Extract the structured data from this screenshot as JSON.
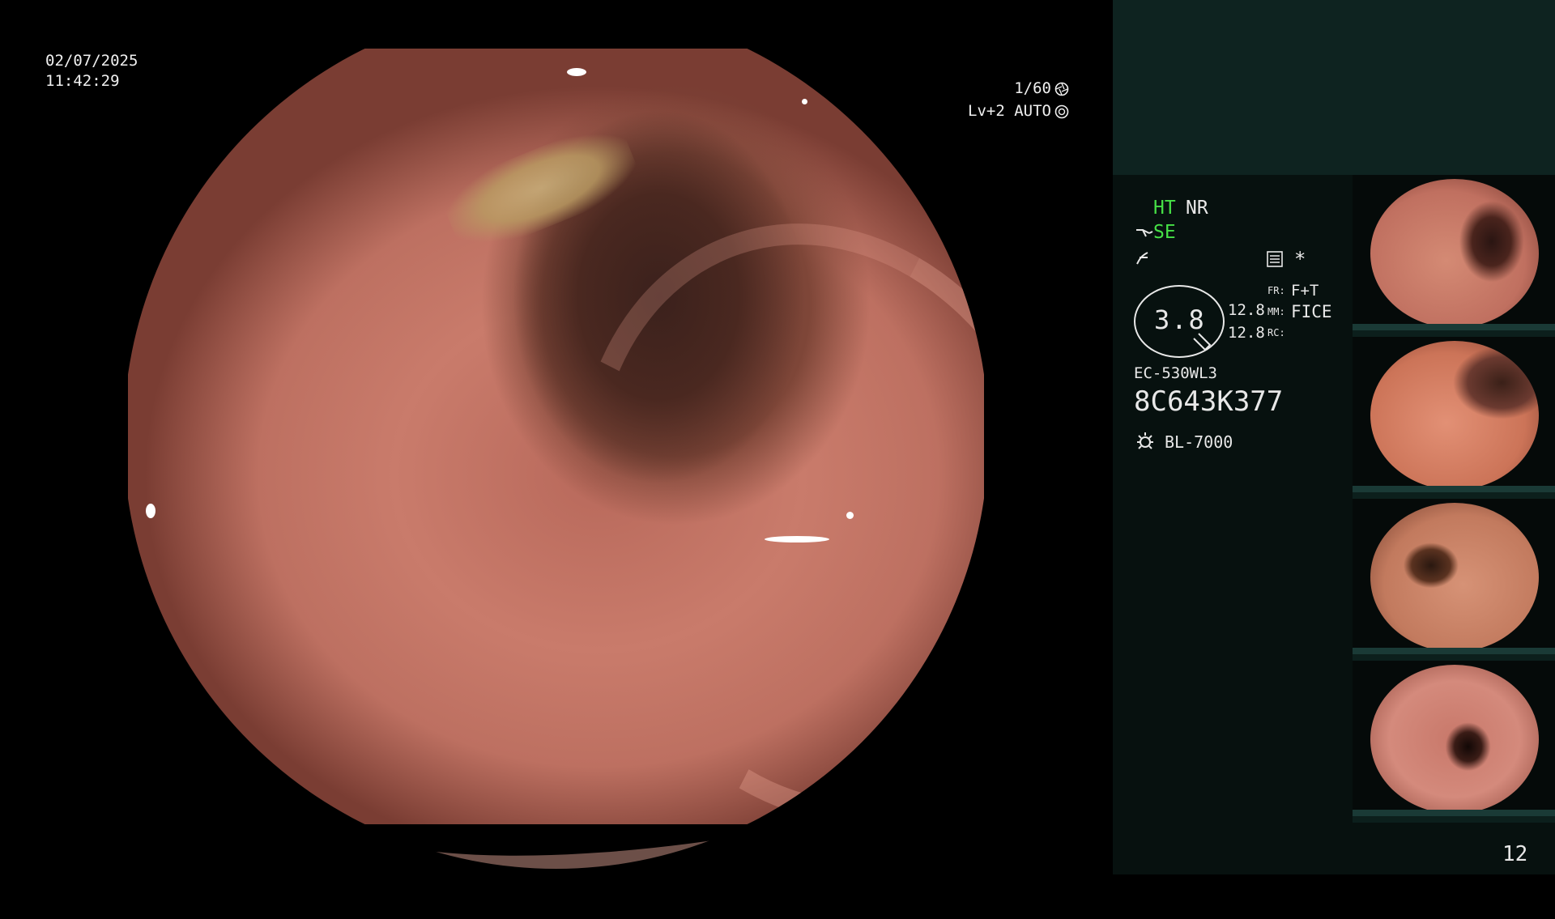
{
  "overlay": {
    "date": "02/07/2025",
    "time": "11:42:29",
    "shutter": "1/60",
    "level": "Lv+2 AUTO"
  },
  "panel": {
    "ht": "HT",
    "nr": "NR",
    "se": "SE",
    "zoom_value": "3.8",
    "val_top": "12.8",
    "val_bottom": "12.8",
    "fr_label": "FR:",
    "fr_value": "F+T",
    "mm_label": "MM:",
    "mm_value": "FICE",
    "rc_label": "RC:",
    "scope_model": "EC-530WL3",
    "serial": "8C643K377",
    "light_source": "BL-7000",
    "frame_number": "12"
  },
  "icons": {
    "shutter": "aperture-icon",
    "auto": "iris-icon",
    "enhance": "edge-enhance-icon",
    "structure": "structure-icon",
    "freeze": "freeze-list-icon",
    "asterisk": "asterisk-icon",
    "light": "sun-icon"
  },
  "colors": {
    "accent_green": "#46e046",
    "panel_bg": "#07110f",
    "panel_top_bg": "#0e2320"
  },
  "thumbnails": [
    {
      "title": "colon-view-1"
    },
    {
      "title": "colon-view-2"
    },
    {
      "title": "colon-view-3"
    },
    {
      "title": "colon-view-4"
    }
  ]
}
